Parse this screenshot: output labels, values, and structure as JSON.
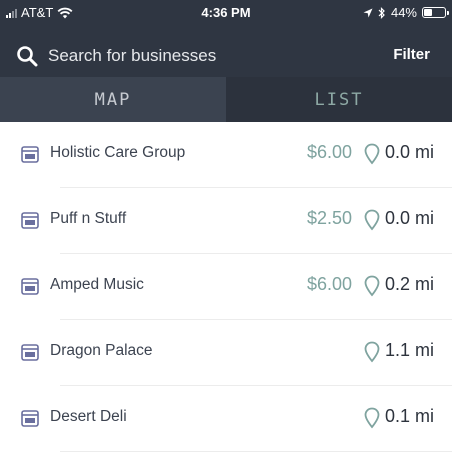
{
  "status_bar": {
    "carrier": "AT&T",
    "time": "4:36 PM",
    "battery": "44%",
    "battery_level": 0.44,
    "signal_bars_filled": 2,
    "signal_bars_total": 4
  },
  "search": {
    "placeholder": "Search for businesses",
    "value": ""
  },
  "filter_label": "Filter",
  "tabs": [
    {
      "label": "MAP",
      "selected": false
    },
    {
      "label": "LIST",
      "selected": true
    }
  ],
  "colors": {
    "header_bg": "#2f3642",
    "accent_teal": "#7fa39f",
    "store_icon": "#6a6f9e"
  },
  "businesses": [
    {
      "name": "Holistic Care Group",
      "price": "$6.00",
      "distance": "0.0 mi"
    },
    {
      "name": "Puff n Stuff",
      "price": "$2.50",
      "distance": "0.0 mi"
    },
    {
      "name": "Amped Music",
      "price": "$6.00",
      "distance": "0.2 mi"
    },
    {
      "name": "Dragon Palace",
      "price": "",
      "distance": "1.1 mi"
    },
    {
      "name": "Desert Deli",
      "price": "",
      "distance": "0.1 mi"
    }
  ]
}
